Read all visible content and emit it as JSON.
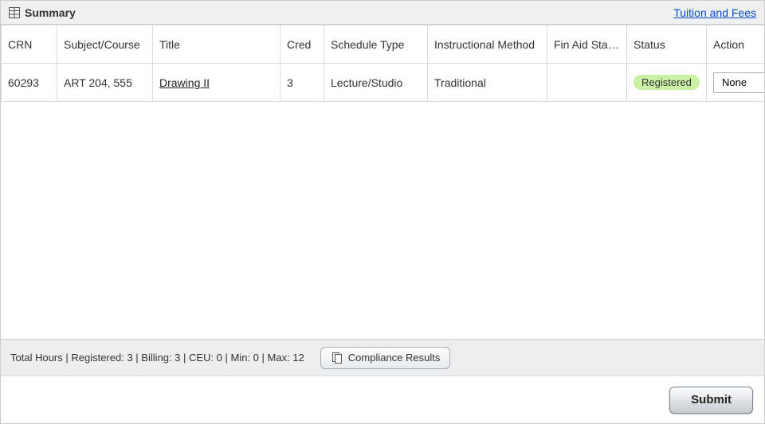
{
  "header": {
    "title": "Summary",
    "link_tuition": "Tuition and Fees"
  },
  "table": {
    "columns": {
      "crn": "CRN",
      "subject_course": "Subject/Course",
      "title": "Title",
      "cred": "Cred",
      "schedule_type": "Schedule Type",
      "instructional_method": "Instructional Method",
      "fin_aid_status": "Fin Aid Status",
      "status": "Status",
      "action": "Action"
    },
    "rows": [
      {
        "crn": "60293",
        "subject_course": "ART 204, 555",
        "title": "Drawing II",
        "cred": "3",
        "schedule_type": "Lecture/Studio",
        "instructional_method": "Traditional",
        "fin_aid_status": "",
        "status": "Registered",
        "action": "None"
      }
    ]
  },
  "footer": {
    "totals_text": "Total Hours | Registered: 3 | Billing: 3 | CEU: 0 | Min: 0 | Max: 12",
    "compliance_label": "Compliance Results"
  },
  "submit": {
    "label": "Submit"
  }
}
